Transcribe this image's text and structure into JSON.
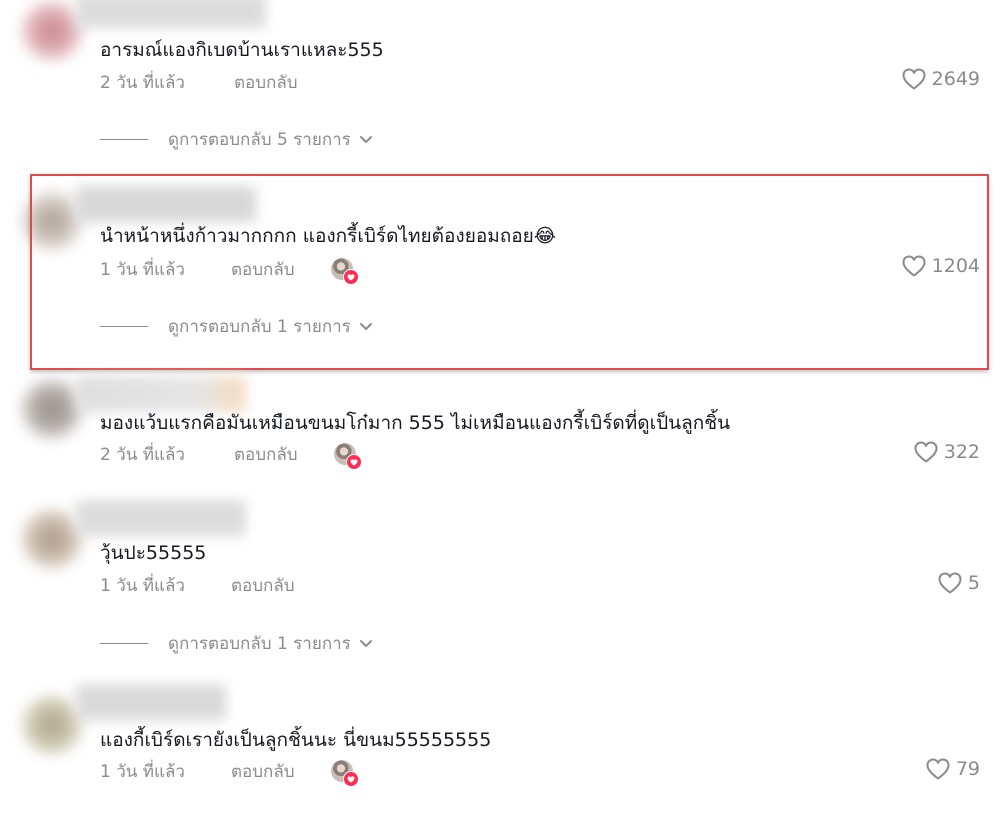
{
  "colors": {
    "text": "#161823",
    "secondary": "#8a8b91",
    "highlight_border": "#e04b4b",
    "like_badge": "#fe2c55"
  },
  "comments": [
    {
      "text": "อารมณ์แองกิเบดบ้านเราแหละ555",
      "time": "2 วัน ที่แล้ว",
      "reply": "ตอบกลับ",
      "likes": "2649",
      "creator_liked": false,
      "view_replies": "ดูการตอบกลับ 5 รายการ",
      "highlighted": false
    },
    {
      "text": "นำหน้าหนึ่งก้าวมากกกก แองกรี้เบิร์ดไทยต้องยอมถอย",
      "emoji": "😂",
      "time": "1 วัน ที่แล้ว",
      "reply": "ตอบกลับ",
      "likes": "1204",
      "creator_liked": true,
      "view_replies": "ดูการตอบกลับ 1 รายการ",
      "highlighted": true
    },
    {
      "text": "มองแว้บแรกคือมันเหมือนขนมโก๋มาก 555 ไม่เหมือนแองกรี้เบิร์ดที่ดูเป็นลูกชิ้น",
      "time": "2 วัน ที่แล้ว",
      "reply": "ตอบกลับ",
      "likes": "322",
      "creator_liked": true,
      "highlighted": false
    },
    {
      "text": "วุ้นปะ55555",
      "time": "1 วัน ที่แล้ว",
      "reply": "ตอบกลับ",
      "likes": "5",
      "creator_liked": false,
      "view_replies": "ดูการตอบกลับ 1 รายการ",
      "highlighted": false
    },
    {
      "text": "แองกี้เบิร์ดเรายังเป็นลูกชิ้นนะ นี่ขนม55555555",
      "time": "1 วัน ที่แล้ว",
      "reply": "ตอบกลับ",
      "likes": "79",
      "creator_liked": true,
      "highlighted": false
    }
  ]
}
